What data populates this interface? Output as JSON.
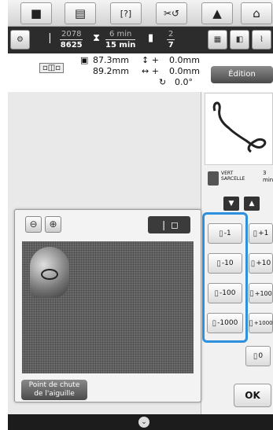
{
  "toolbar": {
    "items": [
      {
        "icon": "camera-icon",
        "glyph": "📷"
      },
      {
        "icon": "page-icon",
        "glyph": "▤"
      },
      {
        "icon": "help-icon",
        "glyph": "[?]"
      },
      {
        "icon": "thread-trim-icon",
        "glyph": "✂↺"
      },
      {
        "icon": "lock-icon",
        "glyph": "🔒"
      },
      {
        "icon": "home-icon",
        "glyph": "⌂"
      }
    ]
  },
  "status": {
    "stitch_current": "2078",
    "stitch_total": "8625",
    "time_current": "6 min",
    "time_total": "15 min",
    "color_current": "2",
    "color_total": "7"
  },
  "info": {
    "width": "87.3mm",
    "height": "89.2mm",
    "offset_v": "0.0mm",
    "offset_h": "0.0mm",
    "angle": "0.0°",
    "edition_label": "Édition"
  },
  "thread": {
    "name_line1": "VERT",
    "name_line2": "SARCELLE",
    "min_value": "3",
    "min_unit": "min"
  },
  "needle_buttons": {
    "minus": [
      "-1",
      "-10",
      "-100",
      "-1000"
    ],
    "plus": [
      "+1",
      "+10",
      "+100",
      "+1000"
    ],
    "zero": "0"
  },
  "dialog": {
    "point_label_line1": "Point de chute",
    "point_label_line2": "de l'aiguille"
  },
  "ok_label": "OK",
  "colors": {
    "highlight": "#2e8fdc",
    "status_bg": "#2c2c2c"
  }
}
